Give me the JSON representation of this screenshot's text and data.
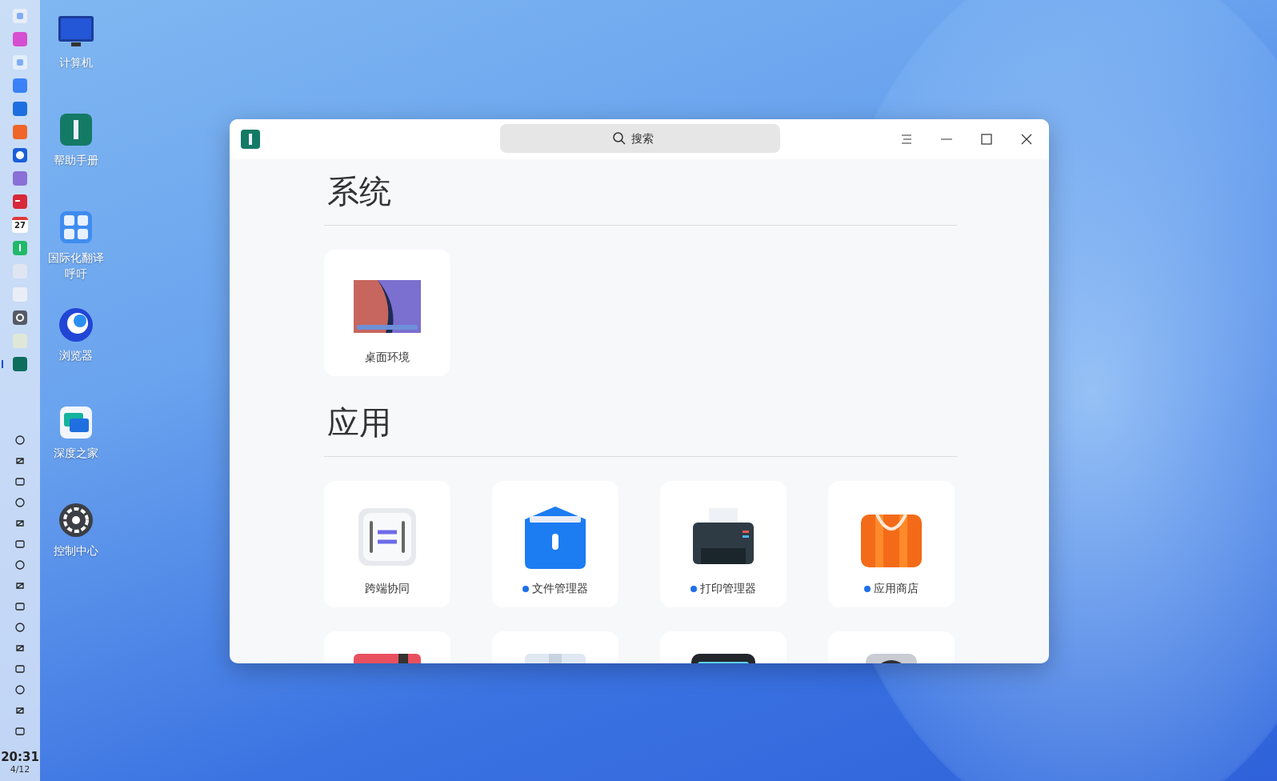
{
  "dock": {
    "apps": [
      {
        "running": false
      },
      {
        "running": false
      },
      {
        "running": false
      },
      {
        "running": false
      },
      {
        "running": false
      },
      {
        "running": false
      },
      {
        "running": false
      },
      {
        "running": false
      },
      {
        "running": false
      },
      {
        "running": false
      },
      {
        "running": false
      },
      {
        "running": false
      },
      {
        "running": false
      },
      {
        "running": false
      },
      {
        "running": false
      },
      {
        "running": true
      }
    ],
    "calendar_day": "27",
    "time": "20:31",
    "date": "4/12"
  },
  "desktop_icons": [
    {
      "kind": "computer",
      "label": "计算机"
    },
    {
      "kind": "manual",
      "label": "帮助手册"
    },
    {
      "kind": "translate",
      "label": "国际化翻译呼吁"
    },
    {
      "kind": "browser",
      "label": "浏览器"
    },
    {
      "kind": "community",
      "label": "深度之家"
    },
    {
      "kind": "settings",
      "label": "控制中心"
    }
  ],
  "window": {
    "search": {
      "placeholder": "搜索"
    },
    "sections": [
      {
        "title": "系统",
        "apps": [
          {
            "kind": "desktop",
            "label": "桌面环境",
            "new": false
          }
        ]
      },
      {
        "title": "应用",
        "apps": [
          {
            "kind": "cooperation",
            "label": "跨端协同",
            "new": false
          },
          {
            "kind": "files",
            "label": "文件管理器",
            "new": true
          },
          {
            "kind": "printer",
            "label": "打印管理器",
            "new": true
          },
          {
            "kind": "store",
            "label": "应用商店",
            "new": true
          },
          {
            "kind": "red"
          },
          {
            "kind": "box"
          },
          {
            "kind": "scanner"
          },
          {
            "kind": "camera"
          }
        ]
      }
    ]
  }
}
